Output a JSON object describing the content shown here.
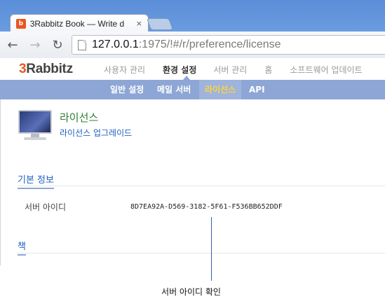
{
  "browser": {
    "tab_title": "3Rabbitz Book — Write d",
    "tab_favicon": "b",
    "close_glyph": "×",
    "url_host": "127.0.0.1",
    "url_rest": ":1975/!#/r/preference/license",
    "back_glyph": "←",
    "forward_glyph": "→",
    "reload_glyph": "↻"
  },
  "app": {
    "logo_num": "3",
    "logo_text": "Rabbitz",
    "nav": [
      "사용자 관리",
      "환경 설정",
      "서버 관리",
      "홈",
      "소프트웨어 업데이트"
    ],
    "active_nav": "환경 설정",
    "subnav": [
      "일반 설정",
      "메일 서버",
      "라이선스",
      "API"
    ],
    "active_subnav": "라이선스"
  },
  "content": {
    "title": "라이선스",
    "upgrade_link": "라이선스 업그레이드",
    "section_basic": "기본 정보",
    "server_id_label": "서버 아이디",
    "server_id_value": "8D7EA92A-D569-3182-5F61-F536BB652DDF",
    "section_book": "책"
  },
  "annotation": {
    "caption": "서버 아이디 확인"
  },
  "colors": {
    "subnav_bg": "#8ea6d5",
    "subnav_active_text": "#ffd23c",
    "title_green": "#2e7d32",
    "link_blue": "#1f5fbf",
    "logo_accent": "#e8561f"
  },
  "icons": [
    "favicon-icon",
    "close-icon",
    "back-icon",
    "forward-icon",
    "reload-icon",
    "page-icon",
    "monitor-icon"
  ]
}
